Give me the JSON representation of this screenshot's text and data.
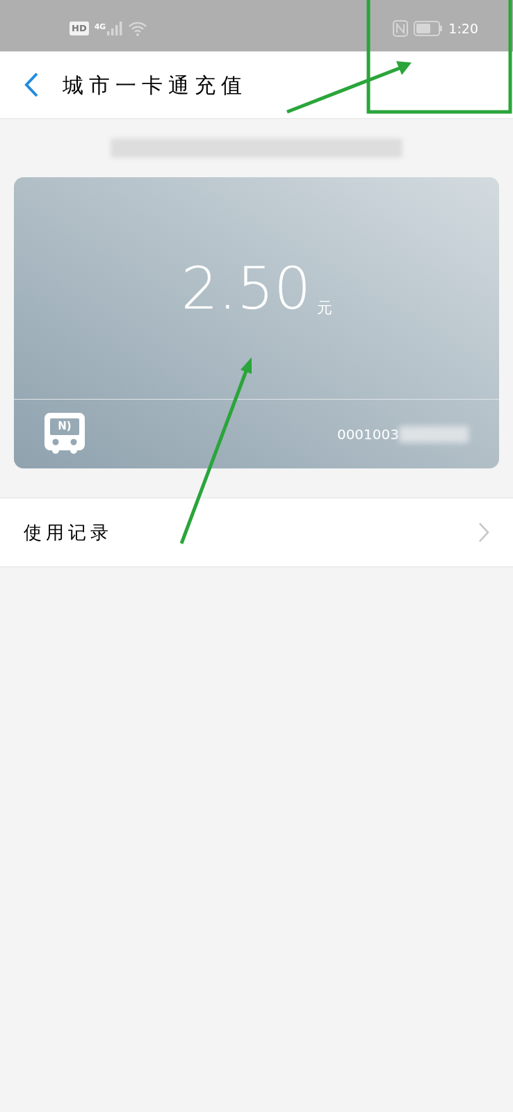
{
  "status_bar": {
    "network": "4G",
    "hd": "HD",
    "time": "1:20"
  },
  "header": {
    "title": "城市一卡通充值"
  },
  "card": {
    "amount": "2.50",
    "unit": "元",
    "bus_badge": "N)",
    "number": "0001003"
  },
  "records_row": {
    "label": "使用记录"
  }
}
